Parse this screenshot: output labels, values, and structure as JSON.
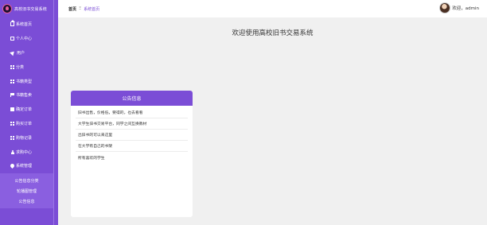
{
  "app": {
    "title": "高校旧书交易系统"
  },
  "sidebar": {
    "items": [
      {
        "label": "系统首页",
        "icon": "home-icon"
      },
      {
        "label": "个人中心",
        "icon": "card-icon"
      },
      {
        "label": "用户",
        "icon": "send-icon"
      },
      {
        "label": "分类",
        "icon": "grid-icon"
      },
      {
        "label": "书籍类型",
        "icon": "grid-icon"
      },
      {
        "label": "书籍售卖",
        "icon": "flag-icon"
      },
      {
        "label": "确定订单",
        "icon": "folder-icon"
      },
      {
        "label": "购买订单",
        "icon": "grid-icon"
      },
      {
        "label": "购物记录",
        "icon": "grid-icon"
      },
      {
        "label": "求购中心",
        "icon": "user-icon"
      },
      {
        "label": "系统管理",
        "icon": "pin-icon"
      }
    ],
    "submenu": [
      {
        "label": "公告信息分类"
      },
      {
        "label": "轮播图管理"
      },
      {
        "label": "公告信息"
      }
    ]
  },
  "header": {
    "breadcrumb_home": "首页",
    "breadcrumb_sep": "Ξ",
    "breadcrumb_current": "系统首页",
    "welcome": "欢迎，admin"
  },
  "main": {
    "welcome_title": "欢迎使用高校旧书交易系统",
    "notice": {
      "title": "公告信息",
      "items": [
        "旧书出售，价格低，要得的，也去看看",
        "大学生旧书交易平台，同学之间互换教材",
        "出旧书的可以来这里",
        "在大学有自己的书架",
        "所有喜欢的学生"
      ]
    }
  },
  "colors": {
    "accent": "#7b4dd6",
    "background": "#f0f0f0"
  }
}
